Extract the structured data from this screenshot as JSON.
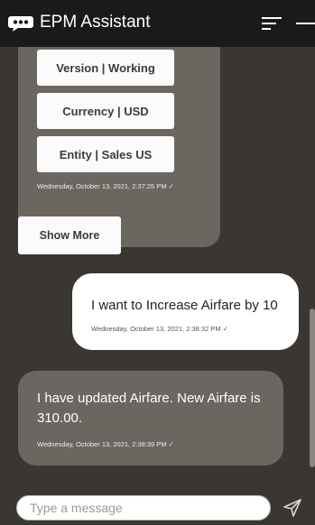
{
  "header": {
    "title": "EPM Assistant",
    "icons": {
      "logo": "chat-bubble-icon",
      "menu": "menu-icon",
      "minimize": "minimize-icon"
    }
  },
  "chat": {
    "bot_card": {
      "options": [
        "Version | Working",
        "Currency | USD",
        "Entity | Sales US"
      ],
      "timestamp": "Wednesday, October 13, 2021, 2:37:25 PM ✓"
    },
    "show_more_label": "Show More",
    "user_message": {
      "text": "I want to Increase Airfare by 10",
      "timestamp": "Wednesday, October 13, 2021, 2:38:32 PM ✓"
    },
    "bot_message": {
      "text": "I have updated Airfare. New  Airfare is 310.00.",
      "timestamp": "Wednesday, October 13, 2021, 2:38:39 PM ✓"
    }
  },
  "footer": {
    "input_placeholder": "Type a message",
    "send_icon": "send-icon"
  },
  "colors": {
    "header_bg": "#1c1a18",
    "chat_bg": "#3a3632",
    "bot_bubble": "#6b6660",
    "user_bubble": "#ffffff"
  }
}
